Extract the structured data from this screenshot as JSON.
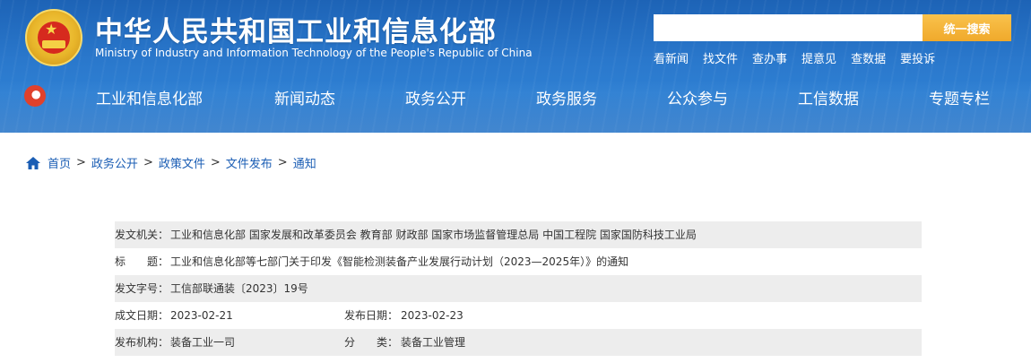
{
  "header": {
    "title_cn": "中华人民共和国工业和信息化部",
    "title_en": "Ministry of Industry and Information Technology of the People's Republic of China",
    "search": {
      "placeholder": "",
      "button_label": "统一搜索"
    },
    "quick_links": [
      "看新闻",
      "找文件",
      "查办事",
      "提意见",
      "查数据",
      "要投诉"
    ],
    "brand_color": "#2a78cc",
    "search_button_color": "#f0a92b"
  },
  "nav": {
    "logo_icon": "miit-logo-icon",
    "items": [
      "工业和信息化部",
      "新闻动态",
      "政务公开",
      "政务服务",
      "公众参与",
      "工信数据",
      "专题专栏"
    ]
  },
  "breadcrumb": {
    "icon": "home-icon",
    "items": [
      "首页",
      "政务公开",
      "政策文件",
      "文件发布",
      "通知"
    ],
    "separator": ">"
  },
  "document_meta": {
    "issuer_label": "发文机关：",
    "issuer_value": "工业和信息化部 国家发展和改革委员会 教育部 财政部 国家市场监督管理总局 中国工程院 国家国防科技工业局",
    "title_label": "标　　题：",
    "title_value": "工业和信息化部等七部门关于印发《智能检测装备产业发展行动计划（2023—2025年）》的通知",
    "doc_no_label": "发文字号：",
    "doc_no_value": "工信部联通装〔2023〕19号",
    "created_label": "成文日期：",
    "created_value": "2023-02-21",
    "published_label": "发布日期：",
    "published_value": "2023-02-23",
    "org_label": "发布机构：",
    "org_value": "装备工业一司",
    "category_label": "分　　类：",
    "category_value": "装备工业管理"
  }
}
